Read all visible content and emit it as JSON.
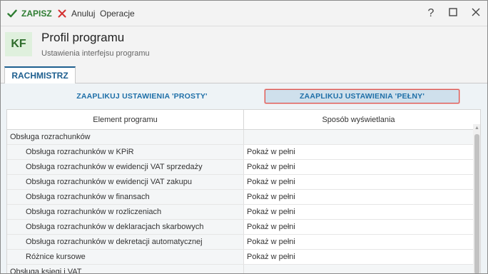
{
  "toolbar": {
    "save_label": "ZAPISZ",
    "cancel_label": "Anuluj",
    "operations_label": "Operacje",
    "help_symbol": "?"
  },
  "header": {
    "logo_text": "KF",
    "title": "Profil programu",
    "subtitle": "Ustawienia interfejsu programu"
  },
  "tabs": [
    {
      "label": "RACHMISTRZ",
      "active": true
    }
  ],
  "actions": {
    "apply_simple": "ZAAPLIKUJ USTAWIENIA 'PROSTY'",
    "apply_full": "ZAAPLIKUJ USTAWIENIA 'PEŁNY'"
  },
  "grid": {
    "columns": [
      "Element programu",
      "Sposób wyświetlania"
    ],
    "rows": [
      {
        "type": "group",
        "element": "Obsługa rozrachunków",
        "display": ""
      },
      {
        "type": "item",
        "element": "Obsługa rozrachunków w KPiR",
        "display": "Pokaż w pełni"
      },
      {
        "type": "item",
        "element": "Obsługa rozrachunków w ewidencji VAT sprzedaży",
        "display": "Pokaż w pełni"
      },
      {
        "type": "item",
        "element": "Obsługa rozrachunków w ewidencji VAT zakupu",
        "display": "Pokaż w pełni"
      },
      {
        "type": "item",
        "element": "Obsługa rozrachunków w finansach",
        "display": "Pokaż w pełni"
      },
      {
        "type": "item",
        "element": "Obsługa rozrachunków w rozliczeniach",
        "display": "Pokaż w pełni"
      },
      {
        "type": "item",
        "element": "Obsługa rozrachunków w deklaracjach skarbowych",
        "display": "Pokaż w pełni"
      },
      {
        "type": "item",
        "element": "Obsługa rozrachunków w dekretacji automatycznej",
        "display": "Pokaż w pełni"
      },
      {
        "type": "item",
        "element": "Różnice kursowe",
        "display": "Pokaż w pełni"
      },
      {
        "type": "group",
        "element": "Obsługa księgi i VAT",
        "display": ""
      }
    ]
  },
  "colors": {
    "accent": "#1e5f8f",
    "save": "#2e7d32",
    "cancel": "#d32f2f",
    "highlight_border": "#d9534f"
  }
}
